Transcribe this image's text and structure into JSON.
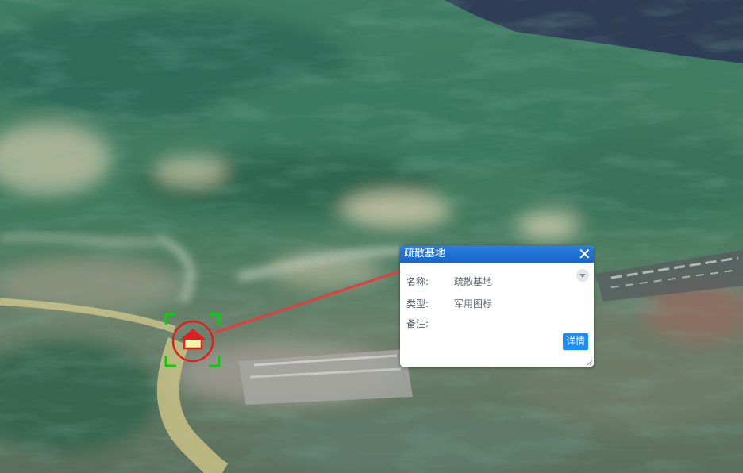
{
  "map": {
    "target_marker": {
      "icon": "house-icon",
      "selection_color": "#00d400",
      "ring_color": "#e02020",
      "house_color": "#e02020",
      "house_fill": "#f3f5a8"
    },
    "leader_line_color": "#e83c3c"
  },
  "popup": {
    "title": "疏散基地",
    "close_label": "✕",
    "fields": [
      {
        "key": "名称:",
        "value": "疏散基地"
      },
      {
        "key": "类型:",
        "value": "军用图标"
      },
      {
        "key": "备注:",
        "value": ""
      }
    ],
    "detail_button": "详情",
    "header_color": "#1a6fd6",
    "button_color": "#1d8ef0"
  }
}
